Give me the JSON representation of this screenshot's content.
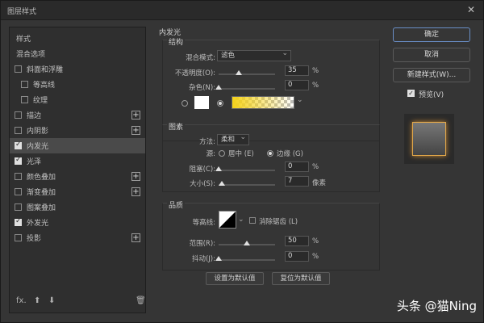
{
  "window": {
    "title": "图层样式",
    "close_glyph": "✕"
  },
  "left_panel": {
    "items": [
      {
        "label": "样式",
        "checkbox": false,
        "checked": false,
        "plus": false,
        "active": false
      },
      {
        "label": "混合选项",
        "checkbox": false,
        "checked": false,
        "plus": false,
        "active": false
      },
      {
        "label": "斜面和浮雕",
        "checkbox": true,
        "checked": false,
        "plus": false,
        "active": false
      },
      {
        "label": "等高线",
        "checkbox": true,
        "checked": false,
        "plus": false,
        "active": false,
        "indent": true
      },
      {
        "label": "纹理",
        "checkbox": true,
        "checked": false,
        "plus": false,
        "active": false,
        "indent": true
      },
      {
        "label": "描边",
        "checkbox": true,
        "checked": false,
        "plus": true,
        "active": false
      },
      {
        "label": "内阴影",
        "checkbox": true,
        "checked": false,
        "plus": true,
        "active": false
      },
      {
        "label": "内发光",
        "checkbox": true,
        "checked": true,
        "plus": false,
        "active": true
      },
      {
        "label": "光泽",
        "checkbox": true,
        "checked": true,
        "plus": false,
        "active": false
      },
      {
        "label": "颜色叠加",
        "checkbox": true,
        "checked": false,
        "plus": true,
        "active": false
      },
      {
        "label": "渐变叠加",
        "checkbox": true,
        "checked": false,
        "plus": true,
        "active": false
      },
      {
        "label": "图案叠加",
        "checkbox": true,
        "checked": false,
        "plus": false,
        "active": false
      },
      {
        "label": "外发光",
        "checkbox": true,
        "checked": true,
        "plus": false,
        "active": false
      },
      {
        "label": "投影",
        "checkbox": true,
        "checked": false,
        "plus": true,
        "active": false
      }
    ],
    "footer": {
      "fx": "fx.",
      "up": "⬆",
      "down": "⬇",
      "trash": "🗑"
    }
  },
  "inner_glow": {
    "title": "内发光",
    "structure": {
      "title": "结构",
      "blend_mode_label": "混合模式:",
      "blend_mode_value": "滤色",
      "opacity_label": "不透明度(O):",
      "opacity_value": "35",
      "opacity_fraction": 0.35,
      "noise_label": "杂色(N):",
      "noise_value": "0",
      "noise_fraction": 0,
      "percent": "%"
    },
    "elements": {
      "title": "图素",
      "method_label": "方法:",
      "method_value": "柔和",
      "source_label": "源:",
      "source_center": "居中 (E)",
      "source_edge": "边缘 (G)",
      "choke_label": "阻塞(C):",
      "choke_value": "0",
      "choke_fraction": 0,
      "size_label": "大小(S):",
      "size_value": "7",
      "size_fraction": 0.05,
      "px": "像素",
      "percent": "%"
    },
    "quality": {
      "title": "品质",
      "contour_label": "等高线:",
      "antialias_label": "消除锯齿 (L)",
      "range_label": "范围(R):",
      "range_value": "50",
      "range_fraction": 0.5,
      "jitter_label": "抖动(J):",
      "jitter_value": "0",
      "jitter_fraction": 0,
      "percent": "%"
    },
    "buttons": {
      "set_default": "设置为默认值",
      "reset_default": "复位为默认值"
    }
  },
  "right_panel": {
    "ok": "确定",
    "cancel": "取消",
    "new_style": "新建样式(W)...",
    "preview_label": "预览(V)",
    "preview_checked": true
  },
  "watermark": "头条 @猫Ning",
  "colors": {
    "glow_gradient_start": "#f5d21a",
    "glow_color": "#ffffff",
    "accent": "#6a8fc7"
  }
}
